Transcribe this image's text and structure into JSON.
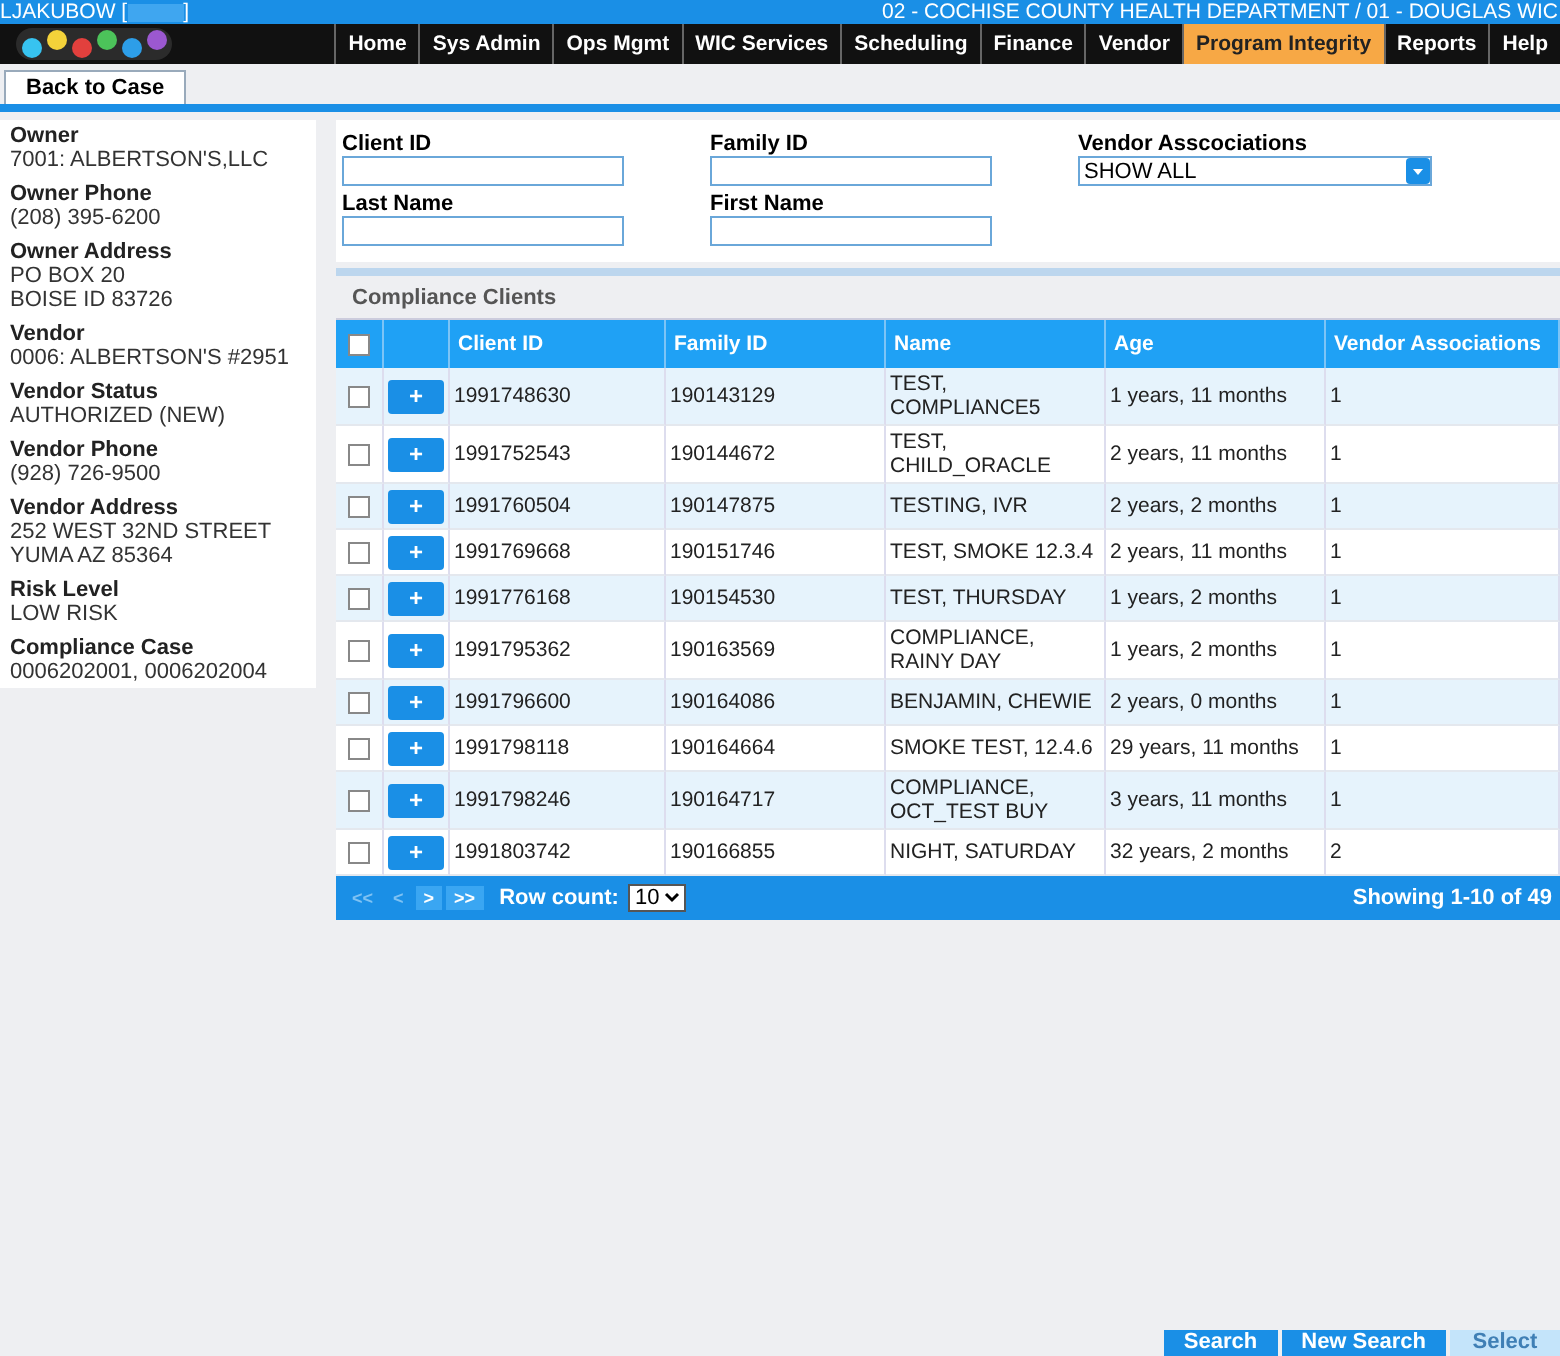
{
  "header": {
    "user_prefix": "LJAKUBOW [",
    "user_suffix": "]",
    "organization": "02 - COCHISE COUNTY HEALTH DEPARTMENT / 01 - DOUGLAS WIC"
  },
  "nav": [
    {
      "label": "Home",
      "selected": false
    },
    {
      "label": "Sys Admin",
      "selected": false
    },
    {
      "label": "Ops Mgmt",
      "selected": false
    },
    {
      "label": "WIC Services",
      "selected": false
    },
    {
      "label": "Scheduling",
      "selected": false
    },
    {
      "label": "Finance",
      "selected": false
    },
    {
      "label": "Vendor",
      "selected": false
    },
    {
      "label": "Program Integrity",
      "selected": true
    },
    {
      "label": "Reports",
      "selected": false
    },
    {
      "label": "Help",
      "selected": false
    }
  ],
  "back_button": "Back to Case",
  "sidebar": [
    {
      "label": "Owner",
      "lines": [
        "7001: ALBERTSON'S,LLC"
      ]
    },
    {
      "label": "Owner Phone",
      "lines": [
        "(208) 395-6200"
      ]
    },
    {
      "label": "Owner Address",
      "lines": [
        "PO BOX 20",
        "BOISE ID 83726"
      ]
    },
    {
      "label": "Vendor",
      "lines": [
        "0006: ALBERTSON'S #2951"
      ]
    },
    {
      "label": "Vendor Status",
      "lines": [
        "AUTHORIZED (NEW)"
      ]
    },
    {
      "label": "Vendor Phone",
      "lines": [
        "(928) 726-9500"
      ]
    },
    {
      "label": "Vendor Address",
      "lines": [
        "252 WEST 32ND STREET",
        "YUMA AZ 85364"
      ]
    },
    {
      "label": "Risk Level",
      "lines": [
        "LOW RISK"
      ]
    },
    {
      "label": "Compliance Case",
      "lines": [
        "0006202001, 0006202004"
      ]
    }
  ],
  "search_form": [
    {
      "kind": "text",
      "label": "Client ID"
    },
    {
      "kind": "text",
      "label": "Family ID"
    },
    {
      "kind": "select",
      "label": "Vendor Asscociations",
      "value": "SHOW ALL"
    },
    {
      "kind": "text",
      "label": "Last Name"
    },
    {
      "kind": "text",
      "label": "First Name"
    }
  ],
  "grid": {
    "title": "Compliance Clients",
    "select_all_checked": false,
    "columns": [
      "Client ID",
      "Family ID",
      "Name",
      "Age",
      "Vendor Associations"
    ],
    "rows": [
      {
        "checked": false,
        "cells": [
          "1991748630",
          "190143129",
          "TEST, COMPLIANCE5",
          "1 years, 11 months",
          "1"
        ]
      },
      {
        "checked": false,
        "cells": [
          "1991752543",
          "190144672",
          "TEST, CHILD_ORACLE",
          "2 years, 11 months",
          "1"
        ]
      },
      {
        "checked": false,
        "cells": [
          "1991760504",
          "190147875",
          "TESTING, IVR",
          "2 years, 2 months",
          "1"
        ]
      },
      {
        "checked": false,
        "cells": [
          "1991769668",
          "190151746",
          "TEST, SMOKE 12.3.4",
          "2 years, 11 months",
          "1"
        ]
      },
      {
        "checked": false,
        "cells": [
          "1991776168",
          "190154530",
          "TEST, THURSDAY",
          "1 years, 2 months",
          "1"
        ]
      },
      {
        "checked": false,
        "cells": [
          "1991795362",
          "190163569",
          "COMPLIANCE, RAINY DAY",
          "1 years, 2 months",
          "1"
        ]
      },
      {
        "checked": false,
        "cells": [
          "1991796600",
          "190164086",
          "BENJAMIN, CHEWIE",
          "2 years, 0 months",
          "1"
        ]
      },
      {
        "checked": false,
        "cells": [
          "1991798118",
          "190164664",
          "SMOKE TEST, 12.4.6",
          "29 years, 11 months",
          "1"
        ]
      },
      {
        "checked": false,
        "cells": [
          "1991798246",
          "190164717",
          "COMPLIANCE, OCT_TEST BUY",
          "3 years, 11 months",
          "1"
        ]
      },
      {
        "checked": false,
        "cells": [
          "1991803742",
          "190166855",
          "NIGHT, SATURDAY",
          "32 years, 2 months",
          "2"
        ]
      }
    ],
    "row_button": "+",
    "pager": [
      {
        "label": "<<",
        "disabled": true
      },
      {
        "label": "<",
        "disabled": true
      },
      {
        "label": ">",
        "disabled": false
      },
      {
        "label": ">>",
        "disabled": false
      }
    ],
    "row_count_label": "Row count:",
    "row_count": "10",
    "showing": "Showing 1-10 of 49"
  },
  "actions": [
    {
      "label": "Search",
      "disabled": false
    },
    {
      "label": "New Search",
      "disabled": false
    },
    {
      "label": "Select",
      "disabled": true
    }
  ]
}
